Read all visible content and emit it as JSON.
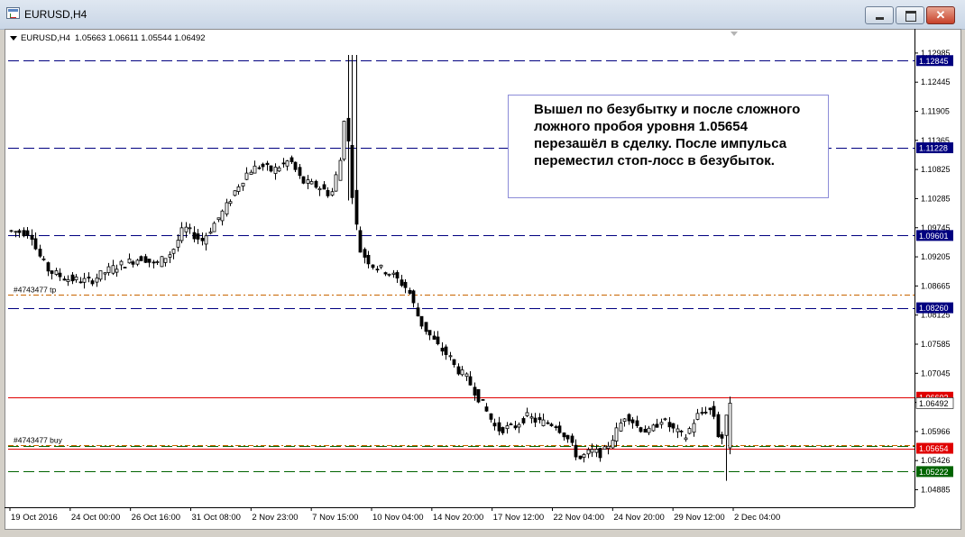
{
  "window": {
    "title": "EURUSD,H4"
  },
  "header": {
    "symbol": "EURUSD,H4",
    "ohlc": "1.05663 1.06611 1.05544 1.06492"
  },
  "note": {
    "text": "Вышел по безубытку и после сложного ложного пробоя уровня 1.05654 перезашёл в сделку. После импульса переместил стоп-лосс в безубыток."
  },
  "colors": {
    "candle": "#000000",
    "level_black": "#000000",
    "level_navy": "#000080",
    "level_red": "#e00000",
    "level_green": "#006400",
    "level_orange": "#c86400",
    "price_tag_navy": "#000080",
    "price_tag_red": "#e00000",
    "price_tag_green": "#006400"
  },
  "chart_data": {
    "type": "candlestick",
    "symbol": "EURUSD",
    "timeframe": "H4",
    "ylim": [
      1.0456,
      1.131
    ],
    "y_ticks": [
      "1.12985",
      "1.12445",
      "1.11905",
      "1.11365",
      "1.10825",
      "1.10285",
      "1.09745",
      "1.09205",
      "1.08665",
      "1.08125",
      "1.07585",
      "1.07045",
      "1.06505",
      "1.05966",
      "1.05426",
      "1.04885"
    ],
    "x_ticks": [
      "19 Oct 2016",
      "24 Oct 00:00",
      "26 Oct 16:00",
      "31 Oct 08:00",
      "2 Nov 23:00",
      "7 Nov 15:00",
      "10 Nov 04:00",
      "14 Nov 20:00",
      "17 Nov 12:00",
      "22 Nov 04:00",
      "24 Nov 20:00",
      "29 Nov 12:00",
      "2 Dec 04:00"
    ],
    "levels": [
      {
        "price": 1.12845,
        "label": "1.12845",
        "style": "dash",
        "color": "#000080",
        "tag": true
      },
      {
        "price": 1.11228,
        "label": "1.11228",
        "style": "dash",
        "color": "#000080",
        "tag": true
      },
      {
        "price": 1.09601,
        "label": "1.09601",
        "style": "dash",
        "color": "#000080",
        "tag": true
      },
      {
        "price": 1.0851,
        "label": "",
        "style": "dashdot",
        "color": "#c86400",
        "tag": false
      },
      {
        "price": 1.0826,
        "label": "1.08260",
        "style": "dash",
        "color": "#000080",
        "tag": true
      },
      {
        "price": 1.06602,
        "label": "1.06602",
        "style": "solid",
        "color": "#e00000",
        "tag": true
      },
      {
        "price": 1.0572,
        "label": "",
        "style": "dashdot",
        "color": "#c86400",
        "tag": false
      },
      {
        "price": 1.0569,
        "label": "",
        "style": "dash",
        "color": "#006400",
        "tag": false
      },
      {
        "price": 1.05654,
        "label": "1.05654",
        "style": "solid",
        "color": "#e00000",
        "tag": true
      },
      {
        "price": 1.05222,
        "label": "1.05222",
        "style": "dash",
        "color": "#006400",
        "tag": true
      }
    ],
    "current_price": {
      "price": 1.06492,
      "label": "1.06492"
    },
    "annotations": [
      {
        "text": "#4743477 tp",
        "price": 1.0851,
        "bar": 1
      },
      {
        "text": "#4743477 buy",
        "price": 1.0572,
        "bar": 1
      }
    ],
    "bars": 178,
    "waypoints": [
      [
        0,
        1.0969
      ],
      [
        8,
        1.0965
      ],
      [
        10,
        1.093
      ],
      [
        14,
        1.0895
      ],
      [
        20,
        1.088
      ],
      [
        28,
        1.0875
      ],
      [
        34,
        1.0895
      ],
      [
        38,
        1.0905
      ],
      [
        46,
        1.092
      ],
      [
        50,
        1.0905
      ],
      [
        56,
        1.093
      ],
      [
        60,
        1.0975
      ],
      [
        66,
        1.095
      ],
      [
        70,
        1.098
      ],
      [
        74,
        1.101
      ],
      [
        78,
        1.105
      ],
      [
        82,
        1.108
      ],
      [
        86,
        1.109
      ],
      [
        90,
        1.108
      ],
      [
        96,
        1.11
      ],
      [
        100,
        1.106
      ],
      [
        106,
        1.105
      ],
      [
        110,
        1.1035
      ],
      [
        114,
        1.112
      ],
      [
        115,
        1.126
      ],
      [
        116,
        1.11
      ],
      [
        118,
        1.0995
      ],
      [
        120,
        1.093
      ],
      [
        124,
        1.0905
      ],
      [
        130,
        1.089
      ],
      [
        136,
        1.086
      ],
      [
        140,
        1.08
      ],
      [
        146,
        1.0755
      ],
      [
        150,
        1.0735
      ],
      [
        152,
        1.0715
      ],
      [
        156,
        1.0695
      ],
      [
        162,
        1.064
      ],
      [
        166,
        1.06
      ],
      [
        172,
        1.0605
      ],
      [
        176,
        1.0625
      ],
      [
        180,
        1.0615
      ],
      [
        186,
        1.061
      ],
      [
        190,
        1.0585
      ],
      [
        194,
        1.0545
      ],
      [
        198,
        1.056
      ],
      [
        202,
        1.0555
      ],
      [
        206,
        1.059
      ],
      [
        210,
        1.063
      ],
      [
        214,
        1.0605
      ],
      [
        218,
        1.0595
      ],
      [
        222,
        1.062
      ],
      [
        226,
        1.06
      ],
      [
        230,
        1.0585
      ],
      [
        234,
        1.0625
      ],
      [
        238,
        1.064
      ],
      [
        240,
        1.0625
      ],
      [
        242,
        1.057
      ],
      [
        244,
        1.062
      ]
    ]
  }
}
